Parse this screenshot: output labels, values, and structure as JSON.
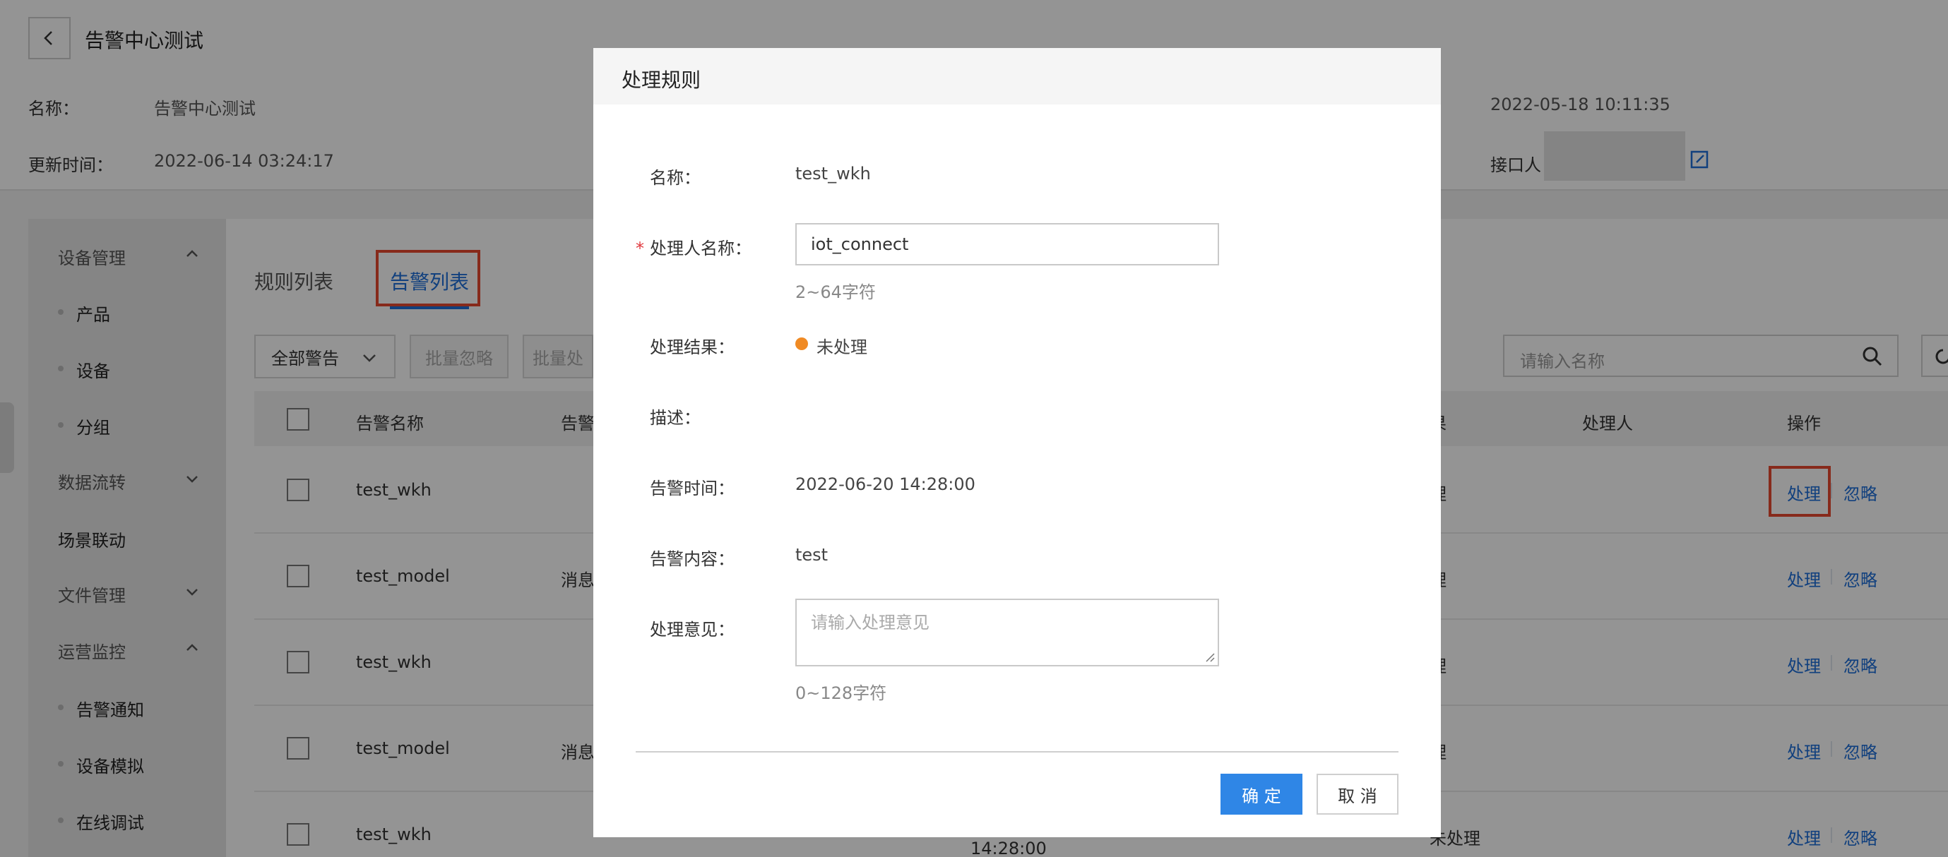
{
  "page": {
    "title": "告警中心测试",
    "meta": {
      "name_label": "名称：",
      "name_value": "告警中心测试",
      "created_value": "2022-05-18 10:11:35",
      "updated_label": "更新时间：",
      "updated_value": "2022-06-14 03:24:17",
      "contact_label": "接口人"
    }
  },
  "sidebar": {
    "items": [
      {
        "label": "设备管理",
        "type": "group",
        "chevron": "up"
      },
      {
        "label": "产品",
        "type": "sub"
      },
      {
        "label": "设备",
        "type": "sub"
      },
      {
        "label": "分组",
        "type": "sub"
      },
      {
        "label": "数据流转",
        "type": "group",
        "chevron": "down"
      },
      {
        "label": "场景联动",
        "type": "plain"
      },
      {
        "label": "文件管理",
        "type": "group",
        "chevron": "down"
      },
      {
        "label": "运营监控",
        "type": "group",
        "chevron": "up"
      },
      {
        "label": "告警通知",
        "type": "sub"
      },
      {
        "label": "设备模拟",
        "type": "sub"
      },
      {
        "label": "在线调试",
        "type": "sub"
      }
    ]
  },
  "tabs": [
    {
      "label": "规则列表",
      "active": false
    },
    {
      "label": "告警列表",
      "active": true
    }
  ],
  "toolbar": {
    "filter_label": "全部警告",
    "bulk_ignore": "批量忽略",
    "bulk_process": "批量处",
    "search_placeholder": "请输入名称"
  },
  "table": {
    "headers": {
      "name": "告警名称",
      "col2": "告警",
      "col_status": "果",
      "handler": "处理人",
      "ops": "操作"
    },
    "rows": [
      {
        "name": "test_wkh",
        "col2": "",
        "status": "理"
      },
      {
        "name": "test_model",
        "col2": "消息",
        "status": "理"
      },
      {
        "name": "test_wkh",
        "col2": "",
        "status": "理"
      },
      {
        "name": "test_model",
        "col2": "消息",
        "status": "理"
      },
      {
        "name": "test_wkh",
        "col2": "",
        "status": "未处理"
      }
    ],
    "row_partial_time": "14:28:00",
    "actions": {
      "process": "处理",
      "ignore": "忽略"
    }
  },
  "modal": {
    "title": "处理规则",
    "name_label": "名称：",
    "name_value": "test_wkh",
    "handler_label": "处理人名称：",
    "handler_value": "iot_connect",
    "handler_hint": "2~64字符",
    "result_label": "处理结果：",
    "result_value": "未处理",
    "desc_label": "描述：",
    "time_label": "告警时间：",
    "time_value": "2022-06-20 14:28:00",
    "content_label": "告警内容：",
    "content_value": "test",
    "opinion_label": "处理意见：",
    "opinion_placeholder": "请输入处理意见",
    "opinion_hint": "0~128字符",
    "ok_label": "确 定",
    "cancel_label": "取 消"
  },
  "colors": {
    "accent": "#2f86e6",
    "link": "#1e6fd9",
    "highlight_box": "#e8492f",
    "status_pending": "#f08a24"
  }
}
